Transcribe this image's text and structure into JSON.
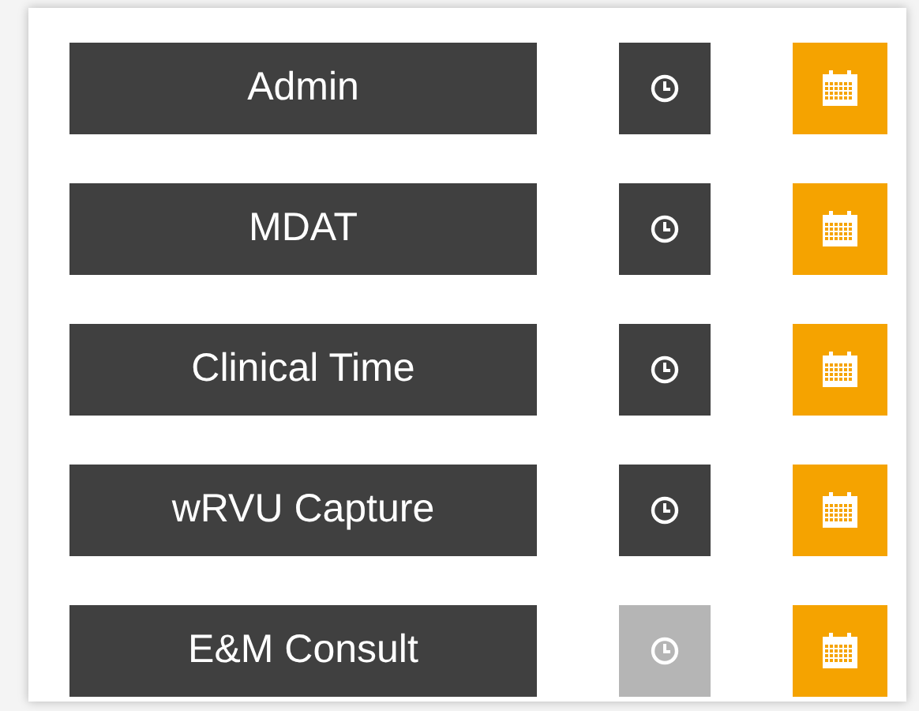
{
  "rows": [
    {
      "label": "Admin",
      "clock_disabled": false
    },
    {
      "label": "MDAT",
      "clock_disabled": false
    },
    {
      "label": "Clinical Time",
      "clock_disabled": false
    },
    {
      "label": "wRVU Capture",
      "clock_disabled": false
    },
    {
      "label": "E&M Consult",
      "clock_disabled": true
    }
  ]
}
